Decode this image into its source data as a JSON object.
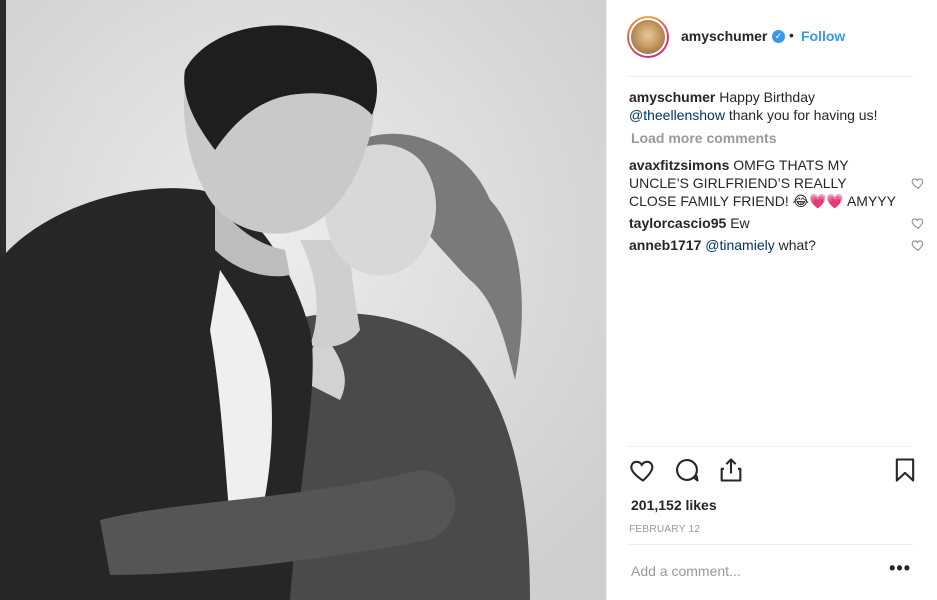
{
  "post": {
    "username": "amyschumer",
    "follow_label": "Follow",
    "separator": "•",
    "caption": {
      "username": "amyschumer",
      "text_before": "Happy Birthday",
      "mention": "@theellenshow",
      "text_after": "thank you for having us!"
    },
    "load_more_label": "Load more comments",
    "comments": [
      {
        "username": "avaxfitzsimons",
        "text": "OMFG THATS MY UNCLE’S GIRLFRIEND’S REALLY CLOSE FAMILY FRIEND! 😂💗💗 AMYYY"
      },
      {
        "username": "taylorcascio95",
        "text": "Ew"
      },
      {
        "username": "anneb1717",
        "mention": "@tinamiely",
        "text": "what?"
      }
    ],
    "likes": "201,152 likes",
    "date": "FEBRUARY 12",
    "add_comment_placeholder": "Add a comment...",
    "more_options": "•••"
  },
  "icons": {
    "verified": "verified-badge-icon",
    "like": "heart-icon",
    "comment": "comment-icon",
    "share": "share-icon",
    "save": "bookmark-icon"
  },
  "colors": {
    "link": "#3897f0",
    "mention": "#003569",
    "muted": "#999999",
    "text": "#262626"
  }
}
